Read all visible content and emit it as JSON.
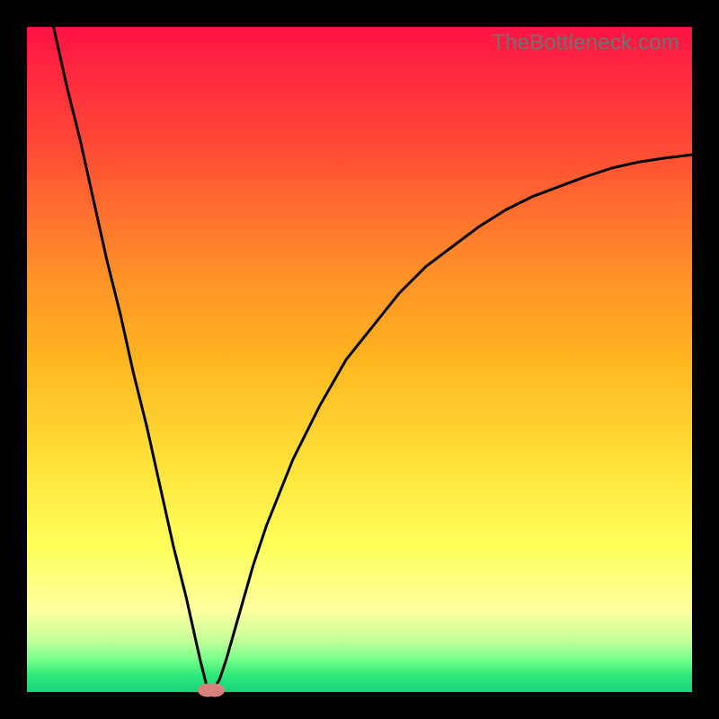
{
  "watermark": "TheBottleneck.com",
  "chart_data": {
    "type": "line",
    "title": "",
    "xlabel": "",
    "ylabel": "",
    "xlim": [
      0,
      100
    ],
    "ylim": [
      0,
      100
    ],
    "grid": false,
    "legend": false,
    "series": [
      {
        "name": "bottleneck-curve",
        "x": [
          4,
          6,
          8,
          10,
          12,
          14,
          16,
          18,
          20,
          22,
          24,
          26,
          27,
          28,
          29,
          30,
          32,
          34,
          36,
          38,
          40,
          44,
          48,
          52,
          56,
          60,
          64,
          68,
          72,
          76,
          80,
          84,
          88,
          92,
          96,
          100
        ],
        "values": [
          100,
          91,
          83,
          74,
          65,
          57,
          48,
          40,
          31,
          22,
          14,
          5,
          1,
          0.3,
          2,
          5,
          12,
          19,
          25,
          30,
          35,
          43,
          50,
          55,
          60,
          64,
          67,
          70,
          72.5,
          74.5,
          76,
          77.5,
          78.8,
          79.7,
          80.3,
          80.8
        ]
      }
    ],
    "markers": [
      {
        "name": "optimal-point-1",
        "x": 27.2,
        "y": 0.3
      },
      {
        "name": "optimal-point-2",
        "x": 28.2,
        "y": 0.3
      }
    ],
    "background_gradient_stops": [
      {
        "pos": 0,
        "color": "#ff1445"
      },
      {
        "pos": 0.18,
        "color": "#ff4a35"
      },
      {
        "pos": 0.35,
        "color": "#ff8a2a"
      },
      {
        "pos": 0.5,
        "color": "#ffb520"
      },
      {
        "pos": 0.65,
        "color": "#ffe038"
      },
      {
        "pos": 0.78,
        "color": "#ffff5a"
      },
      {
        "pos": 0.88,
        "color": "#fbffa0"
      },
      {
        "pos": 0.92,
        "color": "#c8ff9a"
      },
      {
        "pos": 0.95,
        "color": "#7aff8a"
      },
      {
        "pos": 0.975,
        "color": "#2ee87a"
      },
      {
        "pos": 1.0,
        "color": "#18d27a"
      }
    ]
  }
}
